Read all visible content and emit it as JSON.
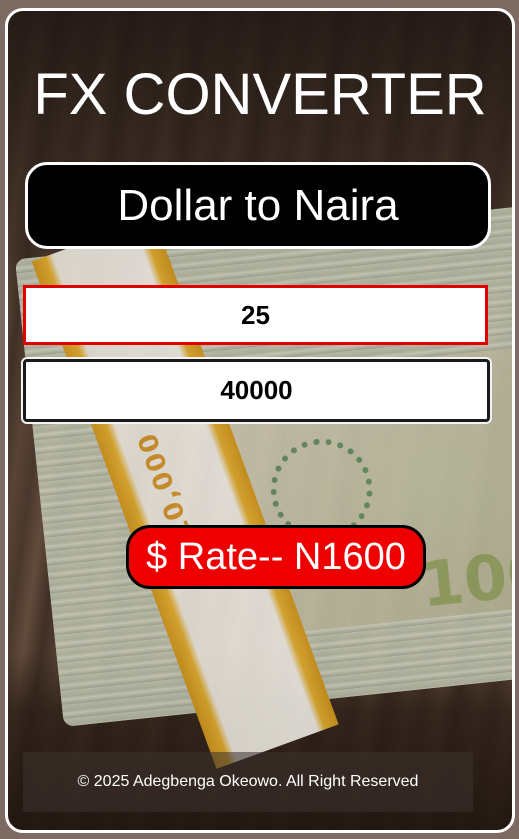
{
  "app": {
    "title": "FX CONVERTER",
    "mode_button_label": "Dollar to Naira"
  },
  "inputs": {
    "amount_value": "25",
    "result_value": "40000"
  },
  "rate": {
    "label": "$ Rate-- N1600"
  },
  "footer": {
    "text": "© 2025 Adegbenga Okeowo. All Right Reserved"
  },
  "colors": {
    "accent_red": "#ee0000",
    "input_border_active": "#e00000",
    "button_bg": "#000000",
    "text": "#ffffff"
  },
  "background": {
    "band_text": "$10,000"
  }
}
